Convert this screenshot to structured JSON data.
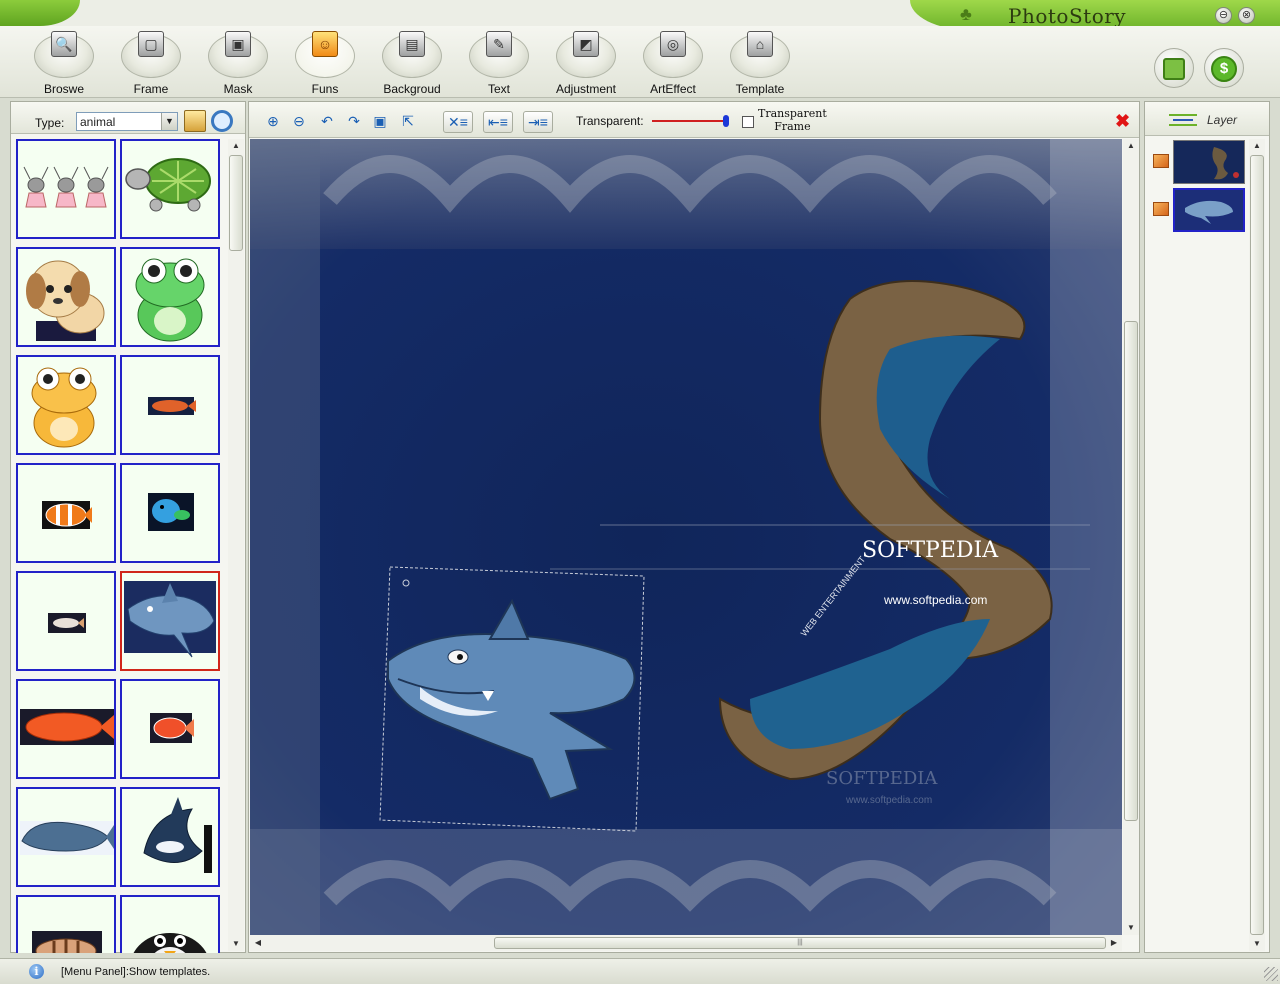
{
  "window": {
    "title": "PhotoStory",
    "minimize_glyph": "⊖",
    "close_glyph": "⊗"
  },
  "toolbar": {
    "tools": [
      {
        "label": "Broswe",
        "icon": "magnifier-icon",
        "glyph": "🔍"
      },
      {
        "label": "Frame",
        "icon": "frame-icon",
        "glyph": "▢"
      },
      {
        "label": "Mask",
        "icon": "mask-icon",
        "glyph": "▣"
      },
      {
        "label": "Funs",
        "icon": "funs-icon",
        "glyph": "☺",
        "active": true
      },
      {
        "label": "Backgroud",
        "icon": "background-icon",
        "glyph": "▤"
      },
      {
        "label": "Text",
        "icon": "text-icon",
        "glyph": "✎"
      },
      {
        "label": "Adjustment",
        "icon": "adjustment-icon",
        "glyph": "◩"
      },
      {
        "label": "ArtEffect",
        "icon": "art-effect-icon",
        "glyph": "◎"
      },
      {
        "label": "Template",
        "icon": "template-icon",
        "glyph": "⌂"
      }
    ],
    "save_icon": "save-icon",
    "purchase_icon": "dollar-icon",
    "purchase_glyph": "$"
  },
  "left_panel": {
    "type_label": "Type:",
    "type_value": "animal",
    "thumbnails": [
      {
        "subject": "three-bunnies"
      },
      {
        "subject": "turtle"
      },
      {
        "subject": "puppy"
      },
      {
        "subject": "green-frog"
      },
      {
        "subject": "orange-frog"
      },
      {
        "subject": "small-red-fish"
      },
      {
        "subject": "clownfish"
      },
      {
        "subject": "blue-fish"
      },
      {
        "subject": "tiny-fish"
      },
      {
        "subject": "shark",
        "selected": true
      },
      {
        "subject": "arowana-fish"
      },
      {
        "subject": "red-goldfish"
      },
      {
        "subject": "whale"
      },
      {
        "subject": "orca"
      },
      {
        "subject": "striped-fish"
      },
      {
        "subject": "penguin"
      }
    ]
  },
  "canvas": {
    "transparent_label": "Transparent:",
    "transparency": 1.0,
    "frame_checkbox_line1": "Transparent",
    "frame_checkbox_line2": "Frame",
    "frame_checked": false,
    "background_texts": {
      "brand": "SOFTPEDIA",
      "url": "www.softpedia.com",
      "tagline": "WEB  ENTERTAINMENT",
      "watermark": "SOFTPEDIA",
      "watermark_url": "www.softpedia.com"
    }
  },
  "layer_panel": {
    "title": "Layer",
    "layers": [
      {
        "name": "background-layer"
      },
      {
        "name": "shark-layer",
        "selected": true
      }
    ]
  },
  "statusbar": {
    "info_glyph": "i",
    "message": "[Menu Panel]:Show templates."
  },
  "colors": {
    "accent_green": "#6cb22a",
    "thumb_border": "#2222c8",
    "thumb_selected": "#d0261a",
    "canvas_ocean": "#10255a"
  }
}
